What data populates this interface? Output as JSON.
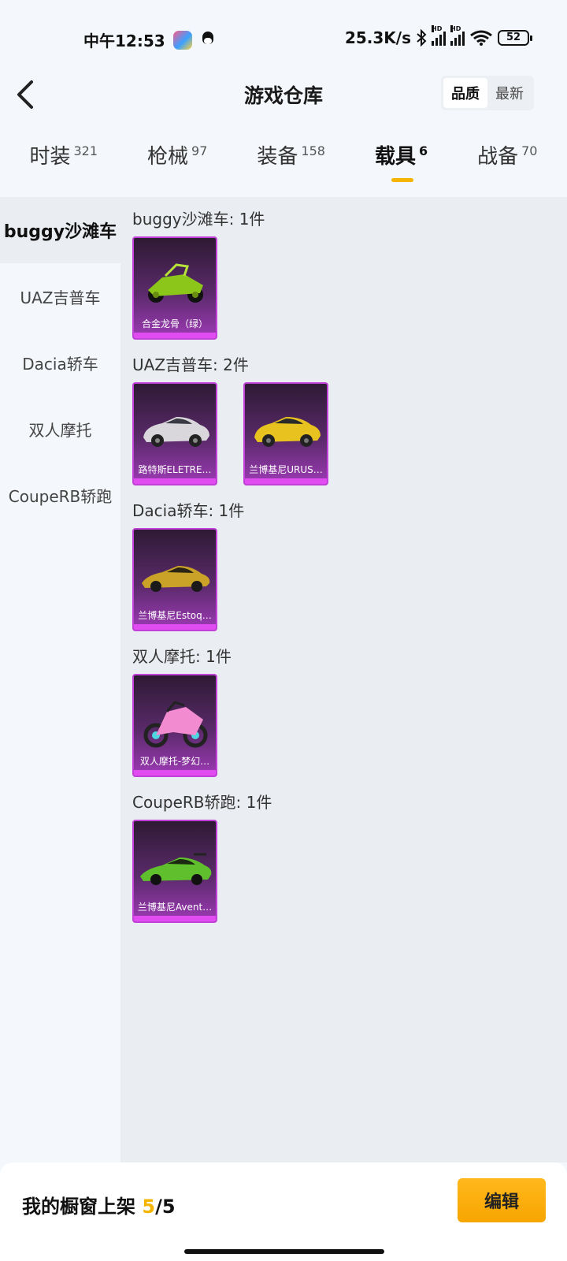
{
  "status_bar": {
    "time": "中午12:53",
    "net_speed": "25.3K/s",
    "signal1_label": "HD",
    "signal2_label": "HD",
    "wifi_sub": "6",
    "battery": "52"
  },
  "header": {
    "title": "游戏仓库",
    "sort_options": [
      "品质",
      "最新"
    ],
    "sort_active": "品质"
  },
  "tabs": [
    {
      "label": "时装",
      "count": "321"
    },
    {
      "label": "枪械",
      "count": "97"
    },
    {
      "label": "装备",
      "count": "158"
    },
    {
      "label": "载具",
      "count": "6"
    },
    {
      "label": "战备",
      "count": "70"
    }
  ],
  "active_tab": "载具",
  "sidebar": {
    "items": [
      "buggy沙滩车",
      "UAZ吉普车",
      "Dacia轿车",
      "双人摩托",
      "CoupeRB轿跑"
    ]
  },
  "sections": [
    {
      "title": "buggy沙滩车: 1件",
      "items": [
        {
          "name": "合金龙骨（绿）"
        }
      ]
    },
    {
      "title": "UAZ吉普车: 2件",
      "items": [
        {
          "name": "路特斯ELETRE…"
        },
        {
          "name": "兰博基尼URUS…"
        }
      ]
    },
    {
      "title": "Dacia轿车: 1件",
      "items": [
        {
          "name": "兰博基尼Estoq…"
        }
      ]
    },
    {
      "title": "双人摩托: 1件",
      "items": [
        {
          "name": "双人摩托-梦幻…"
        }
      ]
    },
    {
      "title": "CoupeRB轿跑: 1件",
      "items": [
        {
          "name": "兰博基尼Avent…"
        }
      ]
    }
  ],
  "bottom": {
    "showcase_label": "我的橱窗上架",
    "showcase_current": "5",
    "showcase_total": "/5",
    "edit_label": "编辑"
  },
  "colors": {
    "accent": "#f5b400",
    "card_border": "#c040d8",
    "card_bg_top": "#2e1a34",
    "card_bg_bottom": "#9d3ab5"
  },
  "icons": {
    "back": "chevron-left-icon",
    "bluetooth": "bluetooth-icon",
    "wifi": "wifi-icon",
    "battery": "battery-icon"
  }
}
